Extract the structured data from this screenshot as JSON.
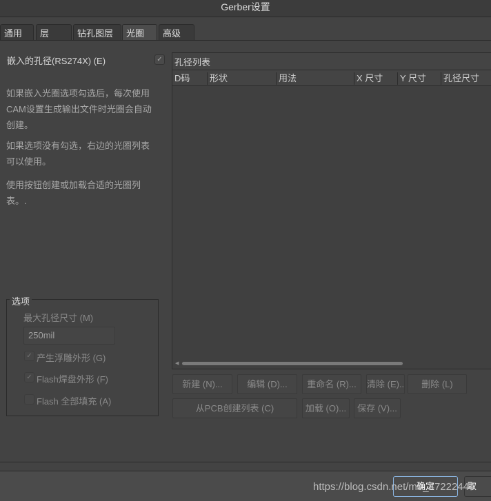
{
  "window": {
    "title": "Gerber设置"
  },
  "tabs": [
    {
      "label": "通用"
    },
    {
      "label": "层"
    },
    {
      "label": "钻孔图层"
    },
    {
      "label": "光圈",
      "active": true
    },
    {
      "label": "高级"
    }
  ],
  "left": {
    "embed_label": "嵌入的孔径(RS274X) (E)",
    "embed_checked": true,
    "para1": "如果嵌入光圈选项勾选后，每次使用CAM设置生成输出文件时光圈会自动创建。",
    "para2": "如果选项没有勾选，右边的光圈列表可以使用。",
    "para3": "使用按钮创建或加载合适的光圈列表。.",
    "options": {
      "title": "选项",
      "max_label": "最大孔径尺寸 (M)",
      "max_value": "250mil",
      "checks": [
        {
          "label": "产生浮雕外形 (G)",
          "checked": true
        },
        {
          "label": "Flash焊盘外形 (F)",
          "checked": true
        },
        {
          "label": "Flash 全部填充 (A)",
          "checked": false
        }
      ]
    }
  },
  "table": {
    "title": "孔径列表",
    "columns": [
      "D码",
      "形状",
      "用法",
      "X 尺寸",
      "Y 尺寸",
      "孔径尺寸"
    ],
    "rows": []
  },
  "buttons": {
    "new": "新建 (N)...",
    "edit": "编辑 (D)...",
    "rename": "重命名 (R)...",
    "clear": "清除 (E)..",
    "delete": "删除 (L)",
    "from_pcb": "从PCB创建列表 (C)",
    "load": "加载 (O)...",
    "save": "保存 (V)..."
  },
  "footer": {
    "ok": "确定",
    "cancel": "取"
  },
  "watermark": "https://blog.csdn.net/m0_47222444"
}
